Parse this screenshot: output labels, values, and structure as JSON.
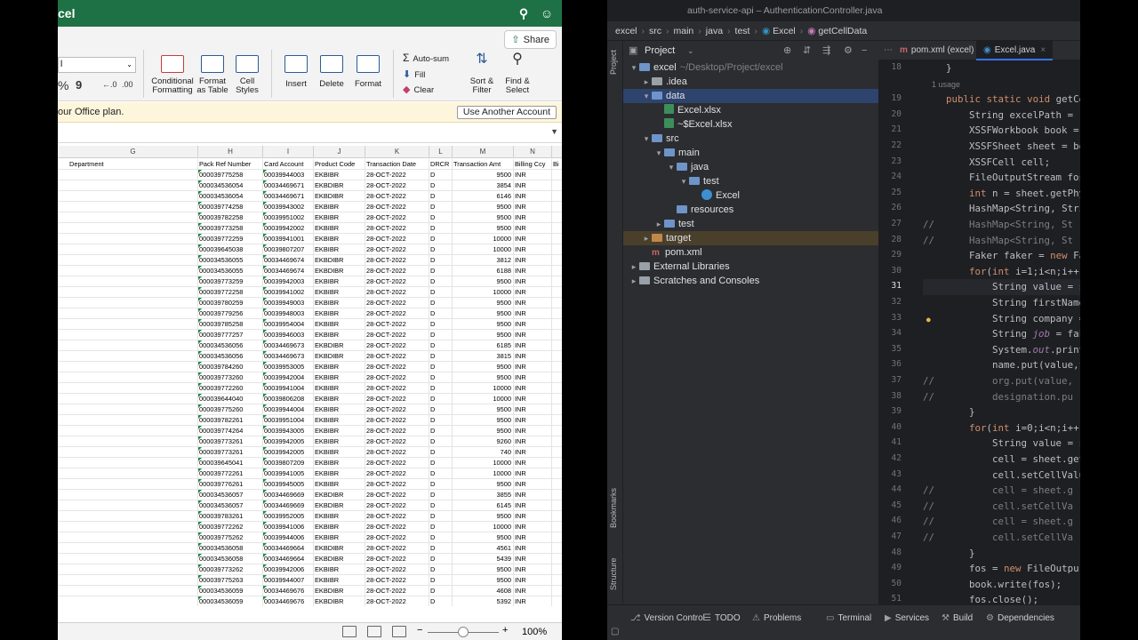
{
  "excel": {
    "title": "cel",
    "share_label": "Share",
    "font_value": "l",
    "ribbon": {
      "conditional_formatting": "Conditional Formatting",
      "format_as_table": "Format as Table",
      "cell_styles": "Cell Styles",
      "insert": "Insert",
      "delete": "Delete",
      "format": "Format",
      "autosum": "Auto-sum",
      "fill": "Fill",
      "clear": "Clear",
      "sort_filter": "Sort & Filter",
      "find_select": "Find & Select",
      "percent": "%",
      "comma": "9"
    },
    "message": "our Office plan.",
    "use_another_account": "Use Another Account",
    "columns": [
      "G",
      "H",
      "I",
      "J",
      "K",
      "L",
      "M",
      "N"
    ],
    "headers": [
      "Department",
      "Pack Ref Number",
      "Card Account",
      "Product Code",
      "Transaction Date",
      "DRCR",
      "Transaction Amt",
      "Billing Ccy",
      "Bi"
    ],
    "rows": [
      [
        "000039775258",
        "00039944003",
        "EKBIBR",
        "28-OCT-2022",
        "D",
        "9500",
        "INR"
      ],
      [
        "000034536054",
        "00034469671",
        "EKBDIBR",
        "28-OCT-2022",
        "D",
        "3854",
        "INR"
      ],
      [
        "000034536054",
        "00034469671",
        "EKBDIBR",
        "28-OCT-2022",
        "D",
        "6146",
        "INR"
      ],
      [
        "000039774258",
        "00039943002",
        "EKBIBR",
        "28-OCT-2022",
        "D",
        "9500",
        "INR"
      ],
      [
        "000039782258",
        "00039951002",
        "EKBIBR",
        "28-OCT-2022",
        "D",
        "9500",
        "INR"
      ],
      [
        "000039773258",
        "00039942002",
        "EKBIBR",
        "28-OCT-2022",
        "D",
        "9500",
        "INR"
      ],
      [
        "000039772259",
        "00039941001",
        "EKBIBR",
        "28-OCT-2022",
        "D",
        "10000",
        "INR"
      ],
      [
        "000039645038",
        "00039807207",
        "EKBIBR",
        "28-OCT-2022",
        "D",
        "10000",
        "INR"
      ],
      [
        "000034536055",
        "00034469674",
        "EKBDIBR",
        "28-OCT-2022",
        "D",
        "3812",
        "INR"
      ],
      [
        "000034536055",
        "00034469674",
        "EKBDIBR",
        "28-OCT-2022",
        "D",
        "6188",
        "INR"
      ],
      [
        "000039773259",
        "00039942003",
        "EKBIBR",
        "28-OCT-2022",
        "D",
        "9500",
        "INR"
      ],
      [
        "000039772258",
        "00039941002",
        "EKBIBR",
        "28-OCT-2022",
        "D",
        "10000",
        "INR"
      ],
      [
        "000039780259",
        "00039949003",
        "EKBIBR",
        "28-OCT-2022",
        "D",
        "9500",
        "INR"
      ],
      [
        "000039779256",
        "00039948003",
        "EKBIBR",
        "28-OCT-2022",
        "D",
        "9500",
        "INR"
      ],
      [
        "000039785258",
        "00039954004",
        "EKBIBR",
        "28-OCT-2022",
        "D",
        "9500",
        "INR"
      ],
      [
        "000039777257",
        "00039946003",
        "EKBIBR",
        "28-OCT-2022",
        "D",
        "9500",
        "INR"
      ],
      [
        "000034536056",
        "00034469673",
        "EKBDIBR",
        "28-OCT-2022",
        "D",
        "6185",
        "INR"
      ],
      [
        "000034536056",
        "00034469673",
        "EKBDIBR",
        "28-OCT-2022",
        "D",
        "3815",
        "INR"
      ],
      [
        "000039784260",
        "00039953005",
        "EKBIBR",
        "28-OCT-2022",
        "D",
        "9500",
        "INR"
      ],
      [
        "000039773260",
        "00039942004",
        "EKBIBR",
        "28-OCT-2022",
        "D",
        "9500",
        "INR"
      ],
      [
        "000039772260",
        "00039941004",
        "EKBIBR",
        "28-OCT-2022",
        "D",
        "10000",
        "INR"
      ],
      [
        "000039644040",
        "00039806208",
        "EKBIBR",
        "28-OCT-2022",
        "D",
        "10000",
        "INR"
      ],
      [
        "000039775260",
        "00039944004",
        "EKBIBR",
        "28-OCT-2022",
        "D",
        "9500",
        "INR"
      ],
      [
        "000039782261",
        "00039951004",
        "EKBIBR",
        "28-OCT-2022",
        "D",
        "9500",
        "INR"
      ],
      [
        "000039774264",
        "00039943005",
        "EKBIBR",
        "28-OCT-2022",
        "D",
        "9500",
        "INR"
      ],
      [
        "000039773261",
        "00039942005",
        "EKBIBR",
        "28-OCT-2022",
        "D",
        "9260",
        "INR"
      ],
      [
        "000039773261",
        "00039942005",
        "EKBIBR",
        "28-OCT-2022",
        "D",
        "740",
        "INR"
      ],
      [
        "000039645041",
        "00039807209",
        "EKBIBR",
        "28-OCT-2022",
        "D",
        "10000",
        "INR"
      ],
      [
        "000039772261",
        "00039941005",
        "EKBIBR",
        "28-OCT-2022",
        "D",
        "10000",
        "INR"
      ],
      [
        "000039776261",
        "00039945005",
        "EKBIBR",
        "28-OCT-2022",
        "D",
        "9500",
        "INR"
      ],
      [
        "000034536057",
        "00034469669",
        "EKBDIBR",
        "28-OCT-2022",
        "D",
        "3855",
        "INR"
      ],
      [
        "000034536057",
        "00034469669",
        "EKBDIBR",
        "28-OCT-2022",
        "D",
        "6145",
        "INR"
      ],
      [
        "000039783261",
        "00039952005",
        "EKBIBR",
        "28-OCT-2022",
        "D",
        "9500",
        "INR"
      ],
      [
        "000039772262",
        "00039941006",
        "EKBIBR",
        "28-OCT-2022",
        "D",
        "10000",
        "INR"
      ],
      [
        "000039775262",
        "00039944006",
        "EKBIBR",
        "28-OCT-2022",
        "D",
        "9500",
        "INR"
      ],
      [
        "000034536058",
        "00034469664",
        "EKBDIBR",
        "28-OCT-2022",
        "D",
        "4561",
        "INR"
      ],
      [
        "000034536058",
        "00034469664",
        "EKBDIBR",
        "28-OCT-2022",
        "D",
        "5439",
        "INR"
      ],
      [
        "000039773262",
        "00039942006",
        "EKBIBR",
        "28-OCT-2022",
        "D",
        "9500",
        "INR"
      ],
      [
        "000039775263",
        "00039944007",
        "EKBIBR",
        "28-OCT-2022",
        "D",
        "9500",
        "INR"
      ],
      [
        "000034536059",
        "00034469676",
        "EKBDIBR",
        "28-OCT-2022",
        "D",
        "4608",
        "INR"
      ],
      [
        "000034536059",
        "00034469676",
        "EKBDIBR",
        "28-OCT-2022",
        "D",
        "5392",
        "INR"
      ]
    ],
    "zoom": "100%"
  },
  "ide": {
    "window_title": "auth-service-api – AuthenticationController.java",
    "breadcrumbs": [
      "excel",
      "src",
      "main",
      "java",
      "test",
      "Excel",
      "getCellData"
    ],
    "project_label": "Project",
    "tabs": [
      "pom.xml (excel)",
      "Excel.java"
    ],
    "tree": [
      {
        "depth": 0,
        "arrow": "▾",
        "icon": "folder",
        "label": "excel",
        "path": "~/Desktop/Project/excel"
      },
      {
        "depth": 1,
        "arrow": "▸",
        "icon": "folder-gray",
        "label": ".idea",
        "path": ""
      },
      {
        "depth": 1,
        "arrow": "▾",
        "icon": "folder",
        "label": "data",
        "path": ""
      },
      {
        "depth": 2,
        "arrow": "",
        "icon": "xlsx",
        "label": "Excel.xlsx",
        "path": ""
      },
      {
        "depth": 2,
        "arrow": "",
        "icon": "xlsx",
        "label": "~$Excel.xlsx",
        "path": ""
      },
      {
        "depth": 1,
        "arrow": "▾",
        "icon": "folder",
        "label": "src",
        "path": ""
      },
      {
        "depth": 2,
        "arrow": "▾",
        "icon": "folder",
        "label": "main",
        "path": ""
      },
      {
        "depth": 3,
        "arrow": "▾",
        "icon": "folder",
        "label": "java",
        "path": ""
      },
      {
        "depth": 4,
        "arrow": "▾",
        "icon": "folder",
        "label": "test",
        "path": ""
      },
      {
        "depth": 5,
        "arrow": "",
        "icon": "java-class",
        "label": "Excel",
        "path": ""
      },
      {
        "depth": 3,
        "arrow": "",
        "icon": "folder",
        "label": "resources",
        "path": ""
      },
      {
        "depth": 2,
        "arrow": "▸",
        "icon": "folder",
        "label": "test",
        "path": ""
      },
      {
        "depth": 1,
        "arrow": "▸",
        "icon": "folder-orange",
        "label": "target",
        "path": ""
      },
      {
        "depth": 1,
        "arrow": "",
        "icon": "maven",
        "label": "pom.xml",
        "path": ""
      },
      {
        "depth": 0,
        "arrow": "▸",
        "icon": "library",
        "label": "External Libraries",
        "path": ""
      },
      {
        "depth": 0,
        "arrow": "▸",
        "icon": "scratch",
        "label": "Scratches and Consoles",
        "path": ""
      }
    ],
    "code": [
      {
        "n": "18",
        "t": "    }"
      },
      {
        "n": "",
        "t": "    1 usage",
        "hint": true
      },
      {
        "n": "19",
        "t": "    public static void getCe"
      },
      {
        "n": "20",
        "t": "        String excelPath = \""
      },
      {
        "n": "21",
        "t": "        XSSFWorkbook book = "
      },
      {
        "n": "22",
        "t": "        XSSFSheet sheet = bo"
      },
      {
        "n": "23",
        "t": "        XSSFCell cell;"
      },
      {
        "n": "24",
        "t": "        FileOutputStream fos"
      },
      {
        "n": "25",
        "t": "        int n = sheet.getPhy"
      },
      {
        "n": "26",
        "t": "        HashMap<String, Stri"
      },
      {
        "n": "27",
        "t": "//      HashMap<String, St",
        "comment": true
      },
      {
        "n": "28",
        "t": "//      HashMap<String, St",
        "comment": true
      },
      {
        "n": "29",
        "t": "        Faker faker = new Fa"
      },
      {
        "n": "30",
        "t": "        for(int i=1;i<n;i++)"
      },
      {
        "n": "31",
        "t": "            String value = s"
      },
      {
        "n": "32",
        "t": "            String firstName"
      },
      {
        "n": "33",
        "t": "            String company ="
      },
      {
        "n": "34",
        "t": "            String job = fak"
      },
      {
        "n": "35",
        "t": "            System.out.print"
      },
      {
        "n": "36",
        "t": "            name.put(value,f"
      },
      {
        "n": "37",
        "t": "//          org.put(value,",
        "comment": true
      },
      {
        "n": "38",
        "t": "//          designation.pu",
        "comment": true
      },
      {
        "n": "39",
        "t": "        }"
      },
      {
        "n": "40",
        "t": "        for(int i=0;i<n;i++)"
      },
      {
        "n": "41",
        "t": "            String value = s"
      },
      {
        "n": "42",
        "t": "            cell = sheet.get"
      },
      {
        "n": "43",
        "t": "            cell.setCellValu"
      },
      {
        "n": "44",
        "t": "//          cell = sheet.g",
        "comment": true
      },
      {
        "n": "45",
        "t": "//          cell.setCellVa",
        "comment": true
      },
      {
        "n": "46",
        "t": "//          cell = sheet.g",
        "comment": true
      },
      {
        "n": "47",
        "t": "//          cell.setCellVa",
        "comment": true
      },
      {
        "n": "48",
        "t": "        }"
      },
      {
        "n": "49",
        "t": "        fos = new FileOutpu"
      },
      {
        "n": "50",
        "t": "        book.write(fos);"
      },
      {
        "n": "51",
        "t": "        fos.close();"
      }
    ],
    "current_line": "31",
    "bottom_tools": [
      "Version Control",
      "TODO",
      "Problems",
      "Terminal",
      "Services",
      "Build",
      "Dependencies"
    ],
    "side_tools": [
      "Project",
      "Bookmarks",
      "Structure"
    ]
  }
}
